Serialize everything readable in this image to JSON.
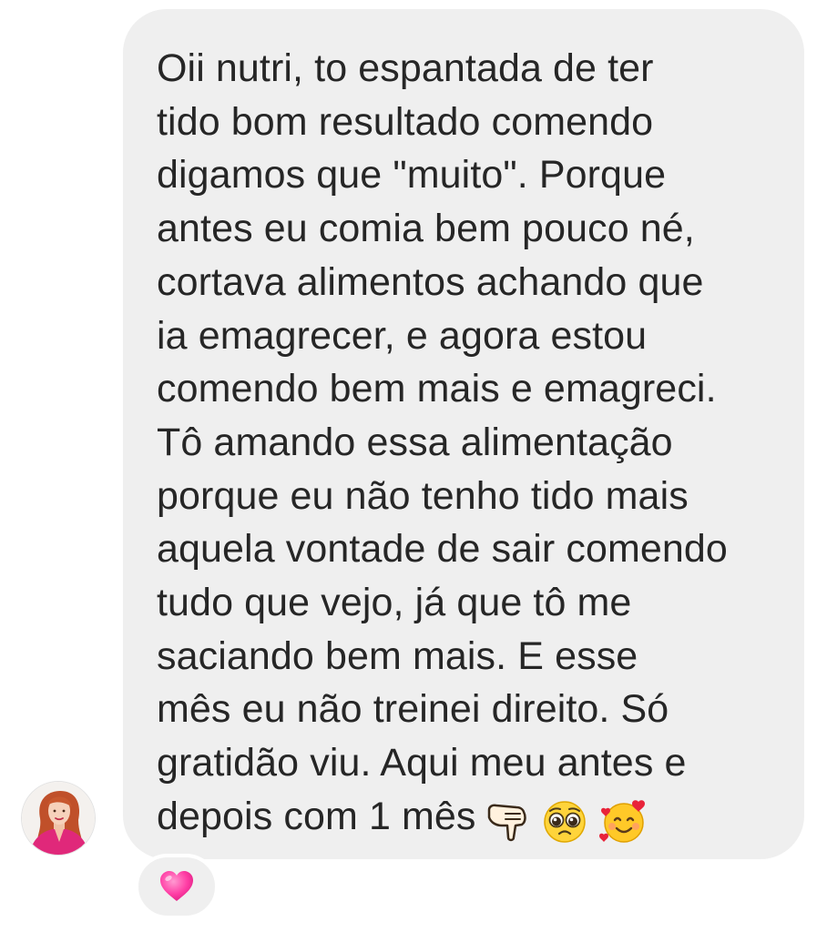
{
  "conversation": {
    "message": {
      "lines": [
        "Oii nutri, to espantada de ter",
        "tido bom resultado comendo",
        "digamos que \"muito\". Porque",
        "antes eu comia bem pouco né,",
        "cortava alimentos achando que",
        "ia emagrecer, e agora estou",
        "comendo bem mais e emagreci.",
        "Tô amando essa alimentação",
        "porque eu não tenho tido mais",
        "aquela vontade de sair comendo",
        "tudo que vejo, já que tô me",
        "saciando bem mais. E esse",
        "mês eu não treinei direito. Só",
        "gratidão viu. Aqui meu antes e",
        "depois com 1 mês"
      ],
      "trailing_emojis": [
        "backhand-index-pointing-down-emoji",
        "pleading-face-emoji",
        "smiling-face-with-hearts-emoji"
      ]
    },
    "reaction": {
      "emoji": "pink-heart-emoji"
    },
    "sender": {
      "avatar": "profile-photo-avatar"
    }
  },
  "colors": {
    "bubble_background": "#efefef",
    "text": "#262626",
    "background": "#ffffff",
    "heart": "#ff3ea5"
  }
}
